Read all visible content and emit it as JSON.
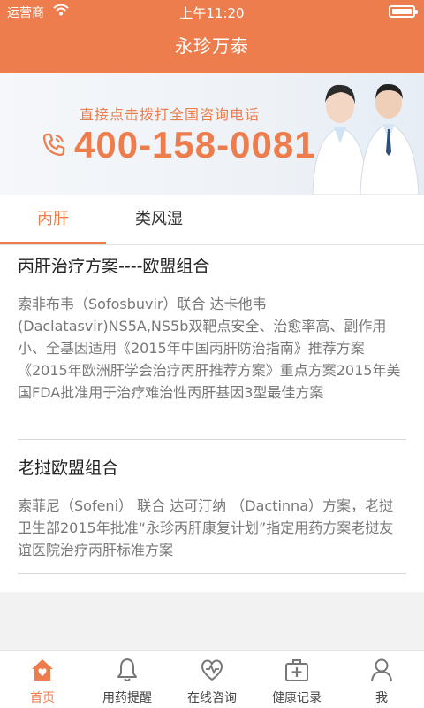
{
  "status_bar": {
    "carrier": "运营商",
    "time": "上午11:20"
  },
  "app_title": "永珍万泰",
  "banner": {
    "cta": "直接点击拨打全国咨询电话",
    "phone": "400-158-0081"
  },
  "tabs": [
    {
      "label": "丙肝",
      "active": true
    },
    {
      "label": "类风湿",
      "active": false
    }
  ],
  "articles": [
    {
      "title": "丙肝治疗方案----欧盟组合",
      "body": "索非布韦（Sofosbuvir）联合 达卡他韦(Daclatasvir)NS5A,NS5b双靶点安全、治愈率高、副作用小、全基因适用《2015年中国丙肝防治指南》推荐方案《2015年欧洲肝学会治疗丙肝推荐方案》重点方案2015年美国FDA批准用于治疗难治性丙肝基因3型最佳方案"
    },
    {
      "title": "老挝欧盟组合",
      "body": "索菲尼（Sofeni） 联合 达可汀纳 （Dactinna）方案，老挝卫生部2015年批准“永珍丙肝康复计划”指定用药方案老挝友谊医院治疗丙肝标准方案"
    }
  ],
  "bottom_nav": [
    {
      "label": "首页",
      "icon": "home-heart-icon",
      "active": true
    },
    {
      "label": "用药提醒",
      "icon": "bell-icon",
      "active": false
    },
    {
      "label": "在线咨询",
      "icon": "heart-stethoscope-icon",
      "active": false
    },
    {
      "label": "健康记录",
      "icon": "medical-kit-icon",
      "active": false
    },
    {
      "label": "我",
      "icon": "user-icon",
      "active": false
    }
  ],
  "colors": {
    "accent": "#ee7d4d",
    "text": "#222222",
    "muted": "#777777"
  }
}
